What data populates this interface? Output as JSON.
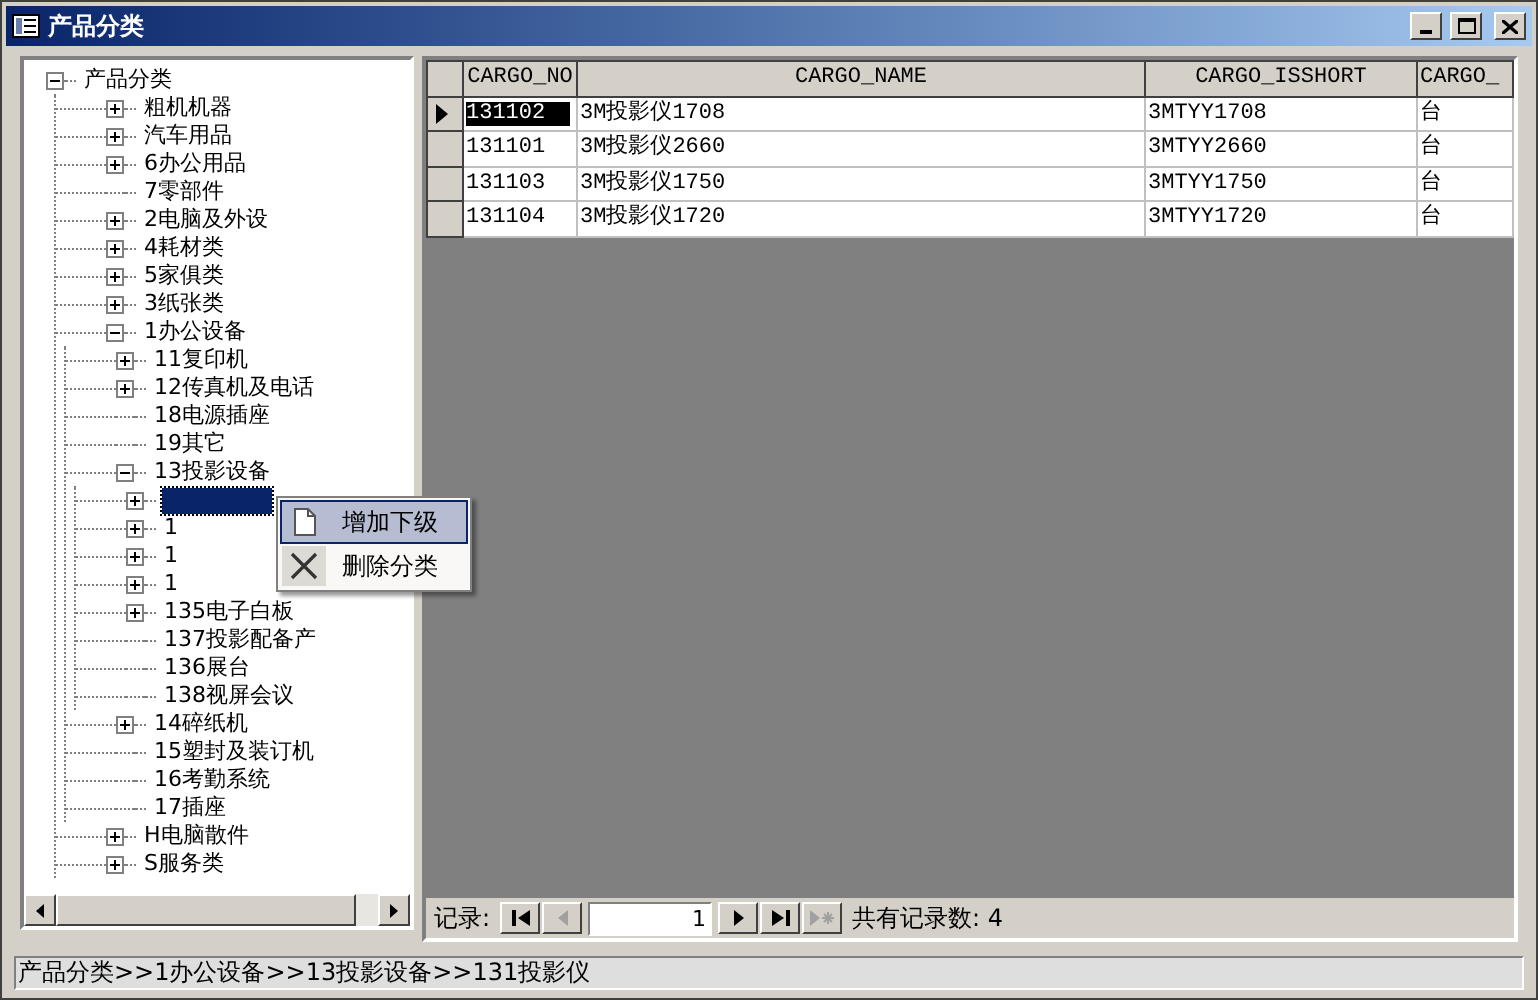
{
  "window": {
    "title": "产品分类"
  },
  "tree": {
    "label": "产品分类",
    "expanded": true,
    "selected": false,
    "children": [
      {
        "label": "粗机机器",
        "expanded": false,
        "selected": false
      },
      {
        "label": "汽车用品",
        "expanded": false,
        "selected": false
      },
      {
        "label": "6办公用品",
        "expanded": false,
        "selected": false
      },
      {
        "label": "7零部件",
        "selected": false
      },
      {
        "label": "2电脑及外设",
        "expanded": false,
        "selected": false
      },
      {
        "label": "4耗材类",
        "expanded": false,
        "selected": false
      },
      {
        "label": "5家俱类",
        "expanded": false,
        "selected": false
      },
      {
        "label": "3纸张类",
        "expanded": false,
        "selected": false
      },
      {
        "label": "1办公设备",
        "expanded": true,
        "selected": false,
        "children": [
          {
            "label": "11复印机",
            "expanded": false,
            "selected": false
          },
          {
            "label": "12传真机及电话",
            "expanded": false,
            "selected": false
          },
          {
            "label": "18电源插座",
            "selected": false
          },
          {
            "label": "19其它",
            "selected": false
          },
          {
            "label": "13投影设备",
            "expanded": true,
            "selected": false,
            "children": [
              {
                "expanded": false,
                "selected": true
              },
              {
                "label": "1",
                "expanded": false,
                "selected": false
              },
              {
                "label": "1",
                "expanded": false,
                "selected": false
              },
              {
                "label": "1",
                "expanded": false,
                "selected": false
              },
              {
                "label": "135电子白板",
                "expanded": false,
                "selected": false
              },
              {
                "label": "137投影配备产",
                "selected": false
              },
              {
                "label": "136展台",
                "selected": false
              },
              {
                "label": "138视屏会议",
                "selected": false
              }
            ]
          },
          {
            "label": "14碎纸机",
            "expanded": false,
            "selected": false
          },
          {
            "label": "15塑封及装订机",
            "selected": false
          },
          {
            "label": "16考勤系统",
            "selected": false
          },
          {
            "label": "17插座",
            "selected": false
          }
        ]
      },
      {
        "label": "H电脑散件",
        "expanded": false,
        "selected": false
      },
      {
        "label": "S服务类",
        "expanded": false,
        "selected": false
      }
    ]
  },
  "context_menu": [
    {
      "label": "增加下级",
      "kind": "page",
      "selected": true
    },
    {
      "label": "删除分类",
      "kind": "cross",
      "selected": false
    }
  ],
  "grid": {
    "columns": [
      "CARGO_NO",
      "CARGO_NAME",
      "CARGO_ISSHORT",
      "CARGO_"
    ],
    "rows": [
      {
        "current": true,
        "cells": [
          "131102",
          "3M投影仪1708",
          "3MTYY1708",
          "台"
        ]
      },
      {
        "current": false,
        "cells": [
          "131101",
          "3M投影仪2660",
          "3MTYY2660",
          "台"
        ]
      },
      {
        "current": false,
        "cells": [
          "131103",
          "3M投影仪1750",
          "3MTYY1750",
          "台"
        ]
      },
      {
        "current": false,
        "cells": [
          "131104",
          "3M投影仪1720",
          "3MTYY1720",
          "台"
        ]
      }
    ]
  },
  "navigator": {
    "label": "记录:",
    "record": "1",
    "total": "共有记录数: 4"
  },
  "status_bar": "产品分类>>1办公设备>>13投影设备>>131投影仪"
}
